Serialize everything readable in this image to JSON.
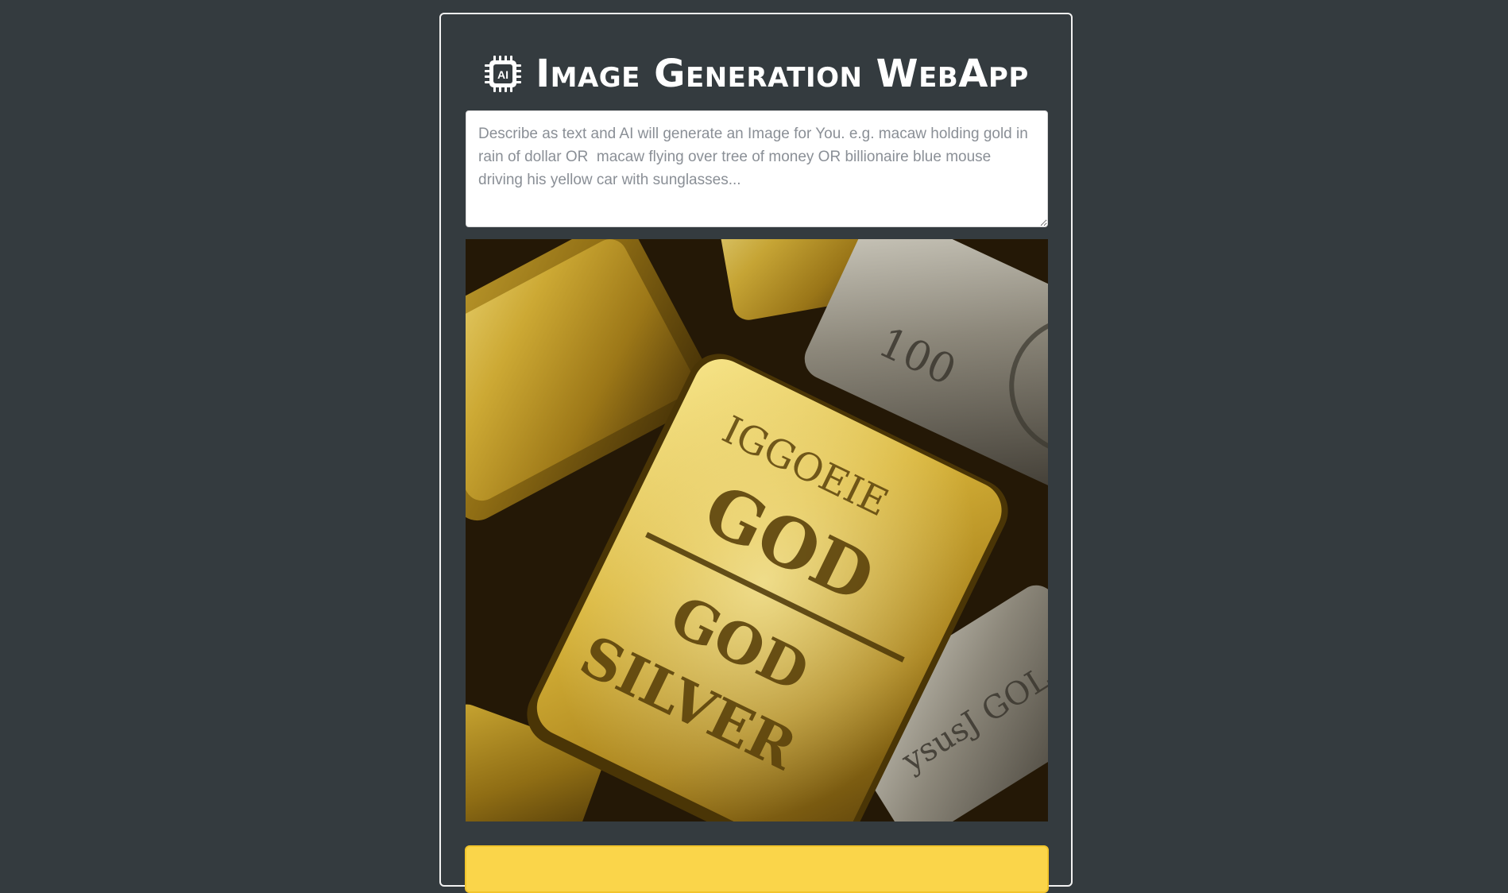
{
  "app": {
    "title": "Image Generation WebApp",
    "icon": "ai-chip-icon",
    "icon_text": "AI"
  },
  "prompt": {
    "value": "",
    "placeholder": "Describe as text and AI will generate an Image for You. e.g. macaw holding gold in rain of dollar OR  macaw flying over tree of money OR billionaire blue mouse driving his yellow car with sunglasses..."
  },
  "generated_image": {
    "description_text_on_bars": [
      "IGGOEIE",
      "GOD",
      "GOD",
      "SILVER",
      "100",
      "YSUSJ GOL"
    ]
  },
  "generate_button": {
    "label": ""
  },
  "colors": {
    "background": "#343b3f",
    "panel_border": "#f2f2f2",
    "button_yellow": "#fad54a"
  }
}
